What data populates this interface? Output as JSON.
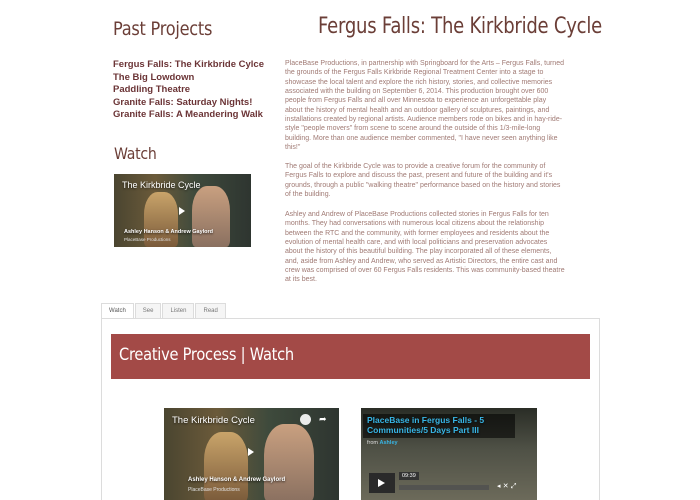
{
  "sidebar": {
    "past_projects_title": "Past Projects",
    "projects": [
      "Fergus Falls: The Kirkbride Cylce",
      "The Big Lowdown",
      "Paddling Theatre",
      "Granite Falls: Saturday Nights!",
      "Granite Falls: A Meandering Walk"
    ],
    "watch_title": "Watch",
    "video": {
      "title": "The Kirkbride Cycle",
      "caption": "Ashley Hanson & Andrew Gaylord",
      "sub_caption": "PlaceBase Productions"
    }
  },
  "main": {
    "title": "Fergus Falls: The Kirkbride Cycle",
    "paragraphs": [
      "PlaceBase Productions, in partnership with Springboard for the Arts – Fergus Falls, turned the grounds of the Fergus Falls Kirkbride Regional Treatment Center into a stage to showcase the local talent and explore the rich history, stories, and collective memories associated with the building on September 6, 2014. This production brought over 600 people from Fergus Falls and all over Minnesota to experience an unforgettable play about the history of mental health and an outdoor gallery of sculptures, paintings, and installations created by regional artists. Audience members rode on bikes and in hay-ride-style \"people movers\" from scene to scene around the outside of this 1/3-mile-long building. More than one audience member commented, \"I have never seen anything like this!\"",
      "The goal of the Kirkbride Cycle was to provide a creative forum for the community of Fergus Falls to explore and discuss the past, present and future of the building and it's grounds, through a public \"walking theatre\" performance based on the history and stories of the building.",
      "Ashley and Andrew of PlaceBase Productions collected stories in Fergus Falls for ten months. They had conversations with numerous local citizens about the relationship between the RTC and the community, with former employees and residents about the evolution of mental health care, and with local politicians and preservation advocates about the history of this beautiful building. The play incorporated all of these elements, and, aside from Ashley and Andrew, who served as Artistic Directors, the entire cast and crew was comprised of over 60 Fergus Falls residents. This was community-based theatre at its best."
    ]
  },
  "tabs": [
    "Watch",
    "See",
    "Listen",
    "Read"
  ],
  "panel": {
    "banner": "Creative Process | Watch",
    "video1": {
      "title": "The Kirkbride Cycle",
      "caption": "Ashley Hanson & Andrew Gaylord",
      "sub_caption": "PlaceBase Productions"
    },
    "video2": {
      "title": "PlaceBase in Fergus Falls - 5 Communities/5 Days Part III",
      "from_label": "from",
      "from_author": "Ashley",
      "duration": "09:39"
    }
  }
}
